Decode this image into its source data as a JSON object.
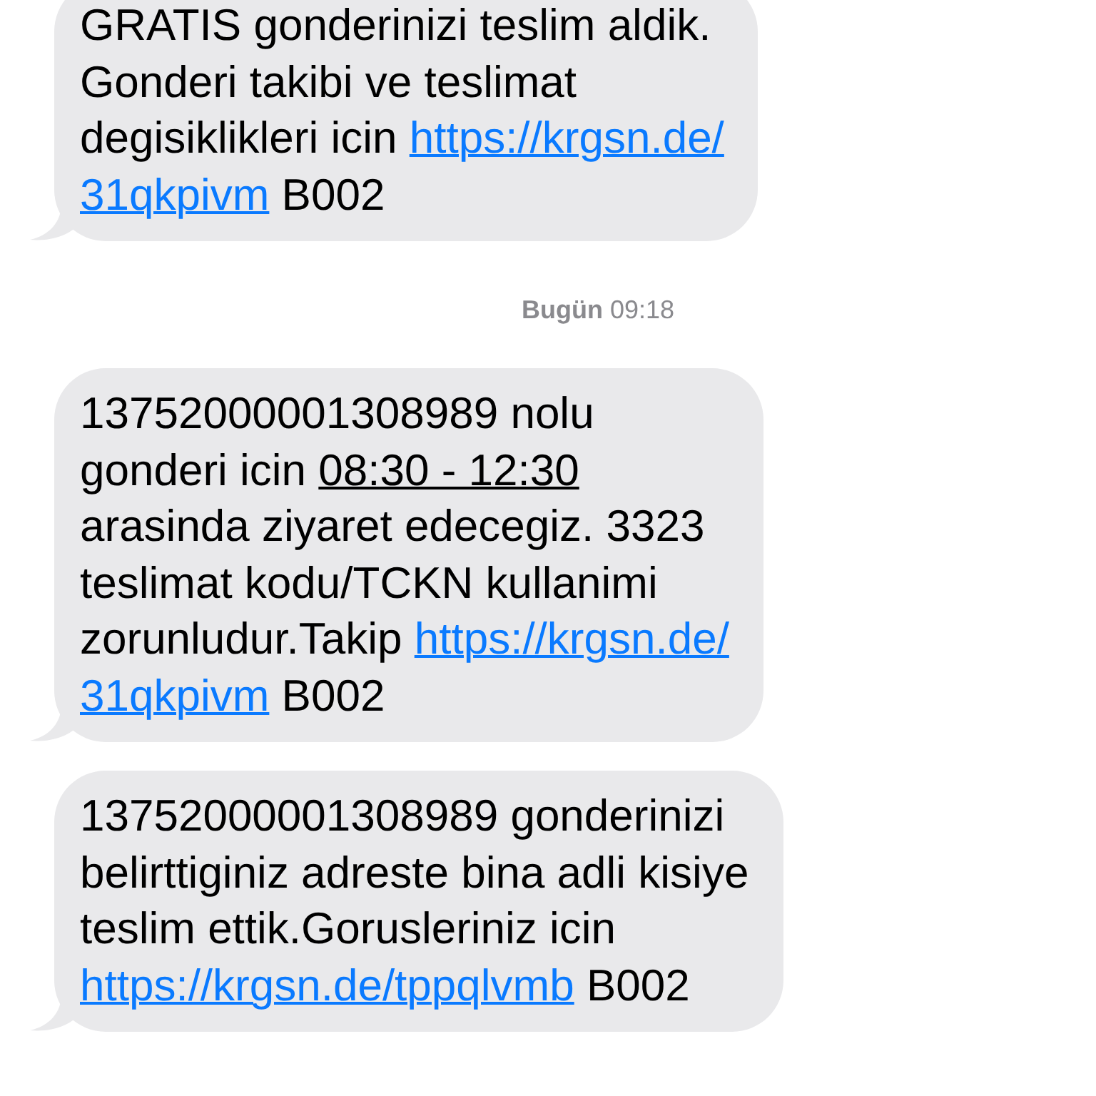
{
  "conversation": [
    {
      "kind": "bubble",
      "lines": [
        [
          {
            "kind": "text",
            "text": "GRATIS gonderinizi teslim aldik."
          }
        ],
        [
          {
            "kind": "text",
            "text": "Gonderi takibi ve teslimat"
          }
        ],
        [
          {
            "kind": "text",
            "text": "degisiklikleri icin "
          },
          {
            "kind": "link",
            "text": "https://krgsn.de/"
          }
        ],
        [
          {
            "kind": "link",
            "text": "31qkpivm"
          },
          {
            "kind": "text",
            "text": " B002"
          }
        ]
      ]
    },
    {
      "kind": "timestamp",
      "text": "**Bugün** 09:18"
    },
    {
      "kind": "bubble",
      "lines": [
        [
          {
            "kind": "text",
            "text": "13752000001308989 nolu"
          }
        ],
        [
          {
            "kind": "text",
            "text": "gonderi icin "
          },
          {
            "kind": "date",
            "text": "08:30 - 12:30"
          }
        ],
        [
          {
            "kind": "text",
            "text": "arasinda ziyaret edecegiz. 3323"
          }
        ],
        [
          {
            "kind": "text",
            "text": "teslimat kodu/TCKN kullanimi"
          }
        ],
        [
          {
            "kind": "text",
            "text": "zorunludur.Takip "
          },
          {
            "kind": "link",
            "text": "https://krgsn.de/"
          }
        ],
        [
          {
            "kind": "link",
            "text": "31qkpivm"
          },
          {
            "kind": "text",
            "text": " B002"
          }
        ]
      ]
    },
    {
      "kind": "bubble",
      "lines": [
        [
          {
            "kind": "text",
            "text": "13752000001308989 gonderinizi"
          }
        ],
        [
          {
            "kind": "text",
            "text": "belirttiginiz adreste bina adli kisiye"
          }
        ],
        [
          {
            "kind": "text",
            "text": "teslim ettik.Gorusleriniz icin"
          }
        ],
        [
          {
            "kind": "link",
            "text": "https://krgsn.de/tppqlvmb"
          },
          {
            "kind": "text",
            "text": " B002"
          }
        ]
      ]
    }
  ]
}
